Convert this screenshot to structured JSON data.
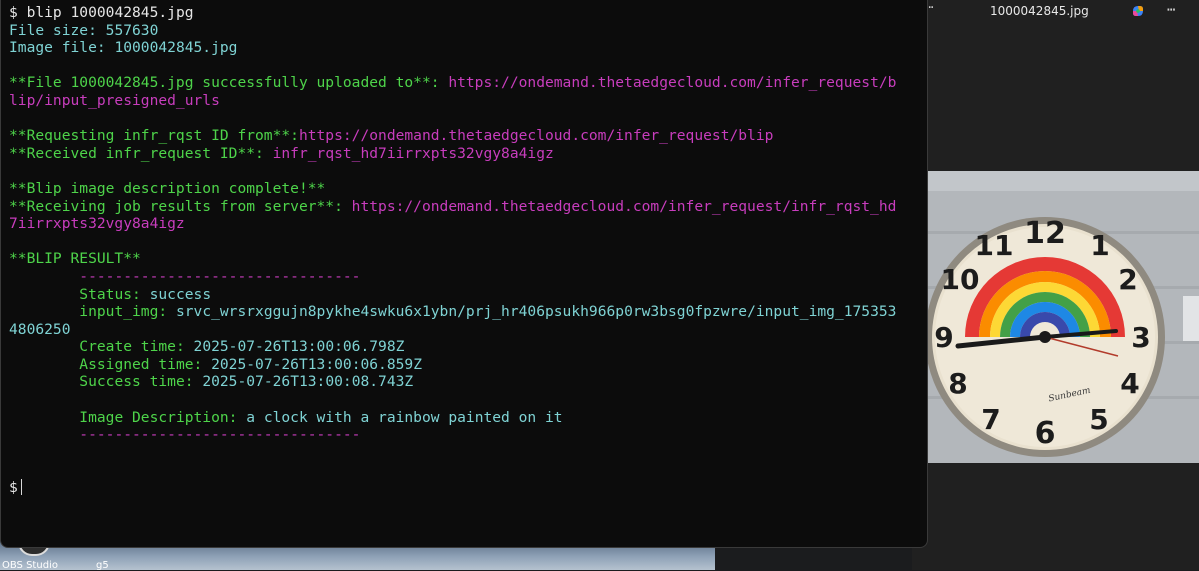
{
  "desktop": {
    "icons": [
      {
        "label": "OBS Studio"
      },
      {
        "label": "g5"
      }
    ]
  },
  "viewer": {
    "title": "1000042845.jpg",
    "more_glyph": "⋯"
  },
  "terminal": {
    "prompt": "$ ",
    "command": "blip 1000042845.jpg",
    "file_size_label": "File size: ",
    "file_size": "557630",
    "image_file_label": "Image file: ",
    "image_file": "1000042845.jpg",
    "upload_msg": "**File 1000042845.jpg successfully uploaded to**:",
    "upload_url_1": "https://ondemand.thetaedgecloud.com/infer_request/b",
    "upload_url_2": "lip/input_presigned_urls",
    "requesting_msg": "**Requesting infr_rqst ID from**:",
    "requesting_url": "https://ondemand.thetaedgecloud.com/infer_request/blip",
    "received_msg": "**Received infr_request ID**:",
    "received_id": "infr_rqst_hd7iirrxpts32vgy8a4igz",
    "complete_msg": "**Blip image description complete!**",
    "receiving_msg": "**Receiving job results from server**:",
    "receiving_url_1": "https://ondemand.thetaedgecloud.com/infer_request/infr_rqst_hd",
    "receiving_url_2": "7iirrxpts32vgy8a4igz",
    "result_header": "**BLIP RESULT**",
    "divider": "--------------------------------",
    "status_label": "Status:",
    "status_value": "success",
    "input_img_label": "input_img:",
    "input_img_value_1": "srvc_wrsrxggujn8pykhe4swku6x1ybn/prj_hr406psukh966p0rw3bsg0fpzwre/input_img_175353",
    "input_img_value_2": "4806250",
    "create_label": "Create time:",
    "create_value": "2025-07-26T13:00:06.798Z",
    "assigned_label": "Assigned time:",
    "assigned_value": "2025-07-26T13:00:06.859Z",
    "success_label": "Success time:",
    "success_value": "2025-07-26T13:00:08.743Z",
    "desc_label": "Image Description:",
    "desc_value": "a clock with a rainbow painted on it",
    "final_prompt": "$"
  },
  "colors": {
    "terminal_bg": "#0c0c0c",
    "cyan": "#7fd3d4",
    "green": "#4ed44a",
    "magenta": "#c83dbd"
  }
}
